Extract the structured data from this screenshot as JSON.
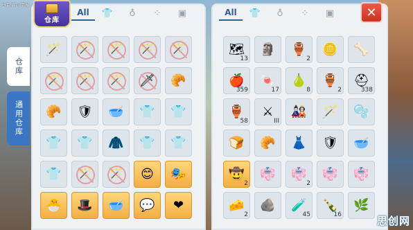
{
  "background": {
    "caption": "仓库/背包/商城"
  },
  "left_panel": {
    "badge_label": "仓库",
    "tabs": [
      {
        "label": "All",
        "icon": ""
      },
      {
        "label": "",
        "icon": "shirt-icon"
      },
      {
        "label": "",
        "icon": "potion-icon"
      },
      {
        "label": "",
        "icon": "grid-icon"
      },
      {
        "label": "",
        "icon": "card-icon"
      }
    ],
    "side_tabs": [
      "仓库",
      "通用仓库"
    ],
    "slots": [
      {
        "icon": "staff-icon",
        "glyph": "🪄",
        "ban": false,
        "qty": "",
        "gold": false
      },
      {
        "icon": "staff-icon",
        "glyph": "🪄",
        "ban": true,
        "qty": "",
        "gold": false
      },
      {
        "icon": "staff-icon",
        "glyph": "🪄",
        "ban": true,
        "qty": "",
        "gold": false
      },
      {
        "icon": "staff-icon",
        "glyph": "🪄",
        "ban": true,
        "qty": "",
        "gold": false
      },
      {
        "icon": "staff-icon",
        "glyph": "🪄",
        "ban": true,
        "qty": "",
        "gold": false
      },
      {
        "icon": "staff-icon",
        "glyph": "🪄",
        "ban": true,
        "qty": "",
        "gold": false
      },
      {
        "icon": "staff-icon",
        "glyph": "🪄",
        "ban": true,
        "qty": "",
        "gold": false
      },
      {
        "icon": "staff-icon",
        "glyph": "🪄",
        "ban": true,
        "qty": "",
        "gold": false
      },
      {
        "icon": "sword-icon",
        "glyph": "🗡",
        "ban": true,
        "qty": "",
        "gold": false
      },
      {
        "icon": "croissant-icon",
        "glyph": "🥐",
        "ban": false,
        "qty": "",
        "gold": false
      },
      {
        "icon": "croissant-icon",
        "glyph": "🥐",
        "ban": false,
        "qty": "",
        "gold": false
      },
      {
        "icon": "armor-icon",
        "glyph": "🛡",
        "ban": false,
        "qty": "",
        "gold": false
      },
      {
        "icon": "bowl-icon",
        "glyph": "🥣",
        "ban": false,
        "qty": "",
        "gold": false
      },
      {
        "icon": "shirt-icon",
        "glyph": "👕",
        "ban": false,
        "qty": "",
        "gold": false
      },
      {
        "icon": "shirt-icon",
        "glyph": "👕",
        "ban": false,
        "qty": "",
        "gold": false
      },
      {
        "icon": "shirt-icon",
        "glyph": "👕",
        "ban": false,
        "qty": "",
        "gold": false
      },
      {
        "icon": "shirt-icon",
        "glyph": "👕",
        "ban": false,
        "qty": "",
        "gold": false
      },
      {
        "icon": "robe-icon",
        "glyph": "🧥",
        "ban": false,
        "qty": "",
        "gold": false
      },
      {
        "icon": "shirt-icon",
        "glyph": "👕",
        "ban": false,
        "qty": "",
        "gold": false
      },
      {
        "icon": "shirt-icon",
        "glyph": "👕",
        "ban": false,
        "qty": "",
        "gold": false
      },
      {
        "icon": "shirt-icon",
        "glyph": "👕",
        "ban": false,
        "qty": "",
        "gold": false
      },
      {
        "icon": "staff-icon",
        "glyph": "🪄",
        "ban": true,
        "qty": "",
        "gold": false
      },
      {
        "icon": "staff-icon",
        "glyph": "🪄",
        "ban": true,
        "qty": "",
        "gold": false
      },
      {
        "icon": "mask-icon",
        "glyph": "😊",
        "ban": false,
        "qty": "",
        "gold": true
      },
      {
        "icon": "ornament-icon",
        "glyph": "🎭",
        "ban": false,
        "qty": "",
        "gold": true
      },
      {
        "icon": "chick-icon",
        "glyph": "🐣",
        "ban": false,
        "qty": "",
        "gold": true
      },
      {
        "icon": "hat-icon",
        "glyph": "🎩",
        "ban": false,
        "qty": "",
        "gold": true
      },
      {
        "icon": "bowl-icon",
        "glyph": "🥣",
        "ban": false,
        "qty": "",
        "gold": true
      },
      {
        "icon": "bubble-icon",
        "glyph": "💬",
        "ban": false,
        "qty": "",
        "gold": true
      },
      {
        "icon": "heart-icon",
        "glyph": "❤",
        "ban": false,
        "qty": "",
        "gold": true
      }
    ]
  },
  "right_panel": {
    "tabs": [
      {
        "label": "All",
        "icon": ""
      },
      {
        "label": "",
        "icon": "shirt-icon"
      },
      {
        "label": "",
        "icon": "potion-icon"
      },
      {
        "label": "",
        "icon": "grid-icon"
      },
      {
        "label": "",
        "icon": "card-icon"
      }
    ],
    "close_label": "✕",
    "slots": [
      {
        "icon": "map-icon",
        "glyph": "🗺",
        "qty": "13",
        "gold": false
      },
      {
        "icon": "figure-icon",
        "glyph": "🗿",
        "qty": "",
        "gold": false
      },
      {
        "icon": "vase-icon",
        "glyph": "🏺",
        "qty": "2",
        "gold": false
      },
      {
        "icon": "coin-icon",
        "glyph": "🪙",
        "qty": "",
        "gold": false
      },
      {
        "icon": "fossil-icon",
        "glyph": "🦴",
        "qty": "",
        "gold": false
      },
      {
        "icon": "apple-icon",
        "glyph": "🍎",
        "qty": "359",
        "gold": false
      },
      {
        "icon": "candy-icon",
        "glyph": "🍬",
        "qty": "17",
        "gold": false
      },
      {
        "icon": "pear-icon",
        "glyph": "🍐",
        "qty": "8",
        "gold": false
      },
      {
        "icon": "jar-icon",
        "glyph": "🏺",
        "qty": "2",
        "gold": false
      },
      {
        "icon": "helmet-icon",
        "glyph": "⛑",
        "qty": "338",
        "gold": false
      },
      {
        "icon": "vase-icon",
        "glyph": "🏺",
        "qty": "58",
        "gold": false
      },
      {
        "icon": "weapon-icon",
        "glyph": "⚔",
        "qty": "III",
        "gold": false
      },
      {
        "icon": "costume-icon",
        "glyph": "🎎",
        "qty": "",
        "gold": false
      },
      {
        "icon": "staff-icon",
        "glyph": "🪄",
        "qty": "",
        "gold": false
      },
      {
        "icon": "slime-icon",
        "glyph": "🫧",
        "qty": "",
        "gold": false
      },
      {
        "icon": "bread-icon",
        "glyph": "🍞",
        "qty": "",
        "gold": false
      },
      {
        "icon": "croissant-icon",
        "glyph": "🥐",
        "qty": "",
        "gold": false
      },
      {
        "icon": "dress-icon",
        "glyph": "👗",
        "qty": "",
        "gold": false
      },
      {
        "icon": "armor-icon",
        "glyph": "🛡",
        "qty": "",
        "gold": false
      },
      {
        "icon": "bowl-icon",
        "glyph": "🥣",
        "qty": "",
        "gold": false
      },
      {
        "icon": "hat-icon",
        "glyph": "🤠",
        "qty": "2",
        "gold": true
      },
      {
        "icon": "clothing-icon",
        "glyph": "👘",
        "qty": "",
        "gold": false
      },
      {
        "icon": "clothing-icon",
        "glyph": "👘",
        "qty": "2",
        "gold": false
      },
      {
        "icon": "clothing-icon",
        "glyph": "👘",
        "qty": "",
        "gold": false
      },
      {
        "icon": "clothing-icon",
        "glyph": "👘",
        "qty": "",
        "gold": false
      },
      {
        "icon": "cheese-icon",
        "glyph": "🧀",
        "qty": "2",
        "gold": false
      },
      {
        "icon": "stone-icon",
        "glyph": "🪨",
        "qty": "",
        "gold": false
      },
      {
        "icon": "potion-icon",
        "glyph": "🧪",
        "qty": "45",
        "gold": false
      },
      {
        "icon": "bottle-icon",
        "glyph": "🍾",
        "qty": "16",
        "gold": false
      },
      {
        "icon": "branch-icon",
        "glyph": "🌿",
        "qty": "",
        "gold": false
      }
    ]
  },
  "watermark": "思创网"
}
